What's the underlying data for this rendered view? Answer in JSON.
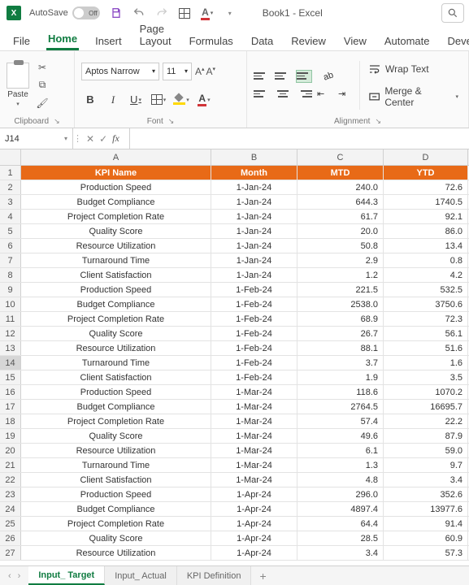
{
  "titlebar": {
    "autosave_label": "AutoSave",
    "autosave_state": "Off",
    "book_title": "Book1  -  Excel"
  },
  "tabs": {
    "file": "File",
    "home": "Home",
    "insert": "Insert",
    "page_layout": "Page Layout",
    "formulas": "Formulas",
    "data": "Data",
    "review": "Review",
    "view": "View",
    "automate": "Automate",
    "developer": "Develop"
  },
  "ribbon": {
    "clipboard": {
      "paste": "Paste",
      "label": "Clipboard"
    },
    "font": {
      "name": "Aptos Narrow",
      "size": "11",
      "label": "Font"
    },
    "alignment": {
      "wrap": "Wrap Text",
      "merge": "Merge & Center",
      "label": "Alignment"
    }
  },
  "namebox": "J14",
  "formula": "",
  "columns": [
    "A",
    "B",
    "C",
    "D"
  ],
  "header_row": {
    "a": "KPI Name",
    "b": "Month",
    "c": "MTD",
    "d": "YTD"
  },
  "rows": [
    {
      "n": "2",
      "a": "Production Speed",
      "b": "1-Jan-24",
      "c": "240.0",
      "d": "72.6"
    },
    {
      "n": "3",
      "a": "Budget Compliance",
      "b": "1-Jan-24",
      "c": "644.3",
      "d": "1740.5"
    },
    {
      "n": "4",
      "a": "Project Completion Rate",
      "b": "1-Jan-24",
      "c": "61.7",
      "d": "92.1"
    },
    {
      "n": "5",
      "a": "Quality Score",
      "b": "1-Jan-24",
      "c": "20.0",
      "d": "86.0"
    },
    {
      "n": "6",
      "a": "Resource Utilization",
      "b": "1-Jan-24",
      "c": "50.8",
      "d": "13.4"
    },
    {
      "n": "7",
      "a": "Turnaround Time",
      "b": "1-Jan-24",
      "c": "2.9",
      "d": "0.8"
    },
    {
      "n": "8",
      "a": "Client Satisfaction",
      "b": "1-Jan-24",
      "c": "1.2",
      "d": "4.2"
    },
    {
      "n": "9",
      "a": "Production Speed",
      "b": "1-Feb-24",
      "c": "221.5",
      "d": "532.5"
    },
    {
      "n": "10",
      "a": "Budget Compliance",
      "b": "1-Feb-24",
      "c": "2538.0",
      "d": "3750.6"
    },
    {
      "n": "11",
      "a": "Project Completion Rate",
      "b": "1-Feb-24",
      "c": "68.9",
      "d": "72.3"
    },
    {
      "n": "12",
      "a": "Quality Score",
      "b": "1-Feb-24",
      "c": "26.7",
      "d": "56.1"
    },
    {
      "n": "13",
      "a": "Resource Utilization",
      "b": "1-Feb-24",
      "c": "88.1",
      "d": "51.6"
    },
    {
      "n": "14",
      "a": "Turnaround Time",
      "b": "1-Feb-24",
      "c": "3.7",
      "d": "1.6"
    },
    {
      "n": "15",
      "a": "Client Satisfaction",
      "b": "1-Feb-24",
      "c": "1.9",
      "d": "3.5"
    },
    {
      "n": "16",
      "a": "Production Speed",
      "b": "1-Mar-24",
      "c": "118.6",
      "d": "1070.2"
    },
    {
      "n": "17",
      "a": "Budget Compliance",
      "b": "1-Mar-24",
      "c": "2764.5",
      "d": "16695.7"
    },
    {
      "n": "18",
      "a": "Project Completion Rate",
      "b": "1-Mar-24",
      "c": "57.4",
      "d": "22.2"
    },
    {
      "n": "19",
      "a": "Quality Score",
      "b": "1-Mar-24",
      "c": "49.6",
      "d": "87.9"
    },
    {
      "n": "20",
      "a": "Resource Utilization",
      "b": "1-Mar-24",
      "c": "6.1",
      "d": "59.0"
    },
    {
      "n": "21",
      "a": "Turnaround Time",
      "b": "1-Mar-24",
      "c": "1.3",
      "d": "9.7"
    },
    {
      "n": "22",
      "a": "Client Satisfaction",
      "b": "1-Mar-24",
      "c": "4.8",
      "d": "3.4"
    },
    {
      "n": "23",
      "a": "Production Speed",
      "b": "1-Apr-24",
      "c": "296.0",
      "d": "352.6"
    },
    {
      "n": "24",
      "a": "Budget Compliance",
      "b": "1-Apr-24",
      "c": "4897.4",
      "d": "13977.6"
    },
    {
      "n": "25",
      "a": "Project Completion Rate",
      "b": "1-Apr-24",
      "c": "64.4",
      "d": "91.4"
    },
    {
      "n": "26",
      "a": "Quality Score",
      "b": "1-Apr-24",
      "c": "28.5",
      "d": "60.9"
    },
    {
      "n": "27",
      "a": "Resource Utilization",
      "b": "1-Apr-24",
      "c": "3.4",
      "d": "57.3"
    }
  ],
  "sheets": {
    "s1": "Input_ Target",
    "s2": "Input_ Actual",
    "s3": "KPI Definition"
  }
}
